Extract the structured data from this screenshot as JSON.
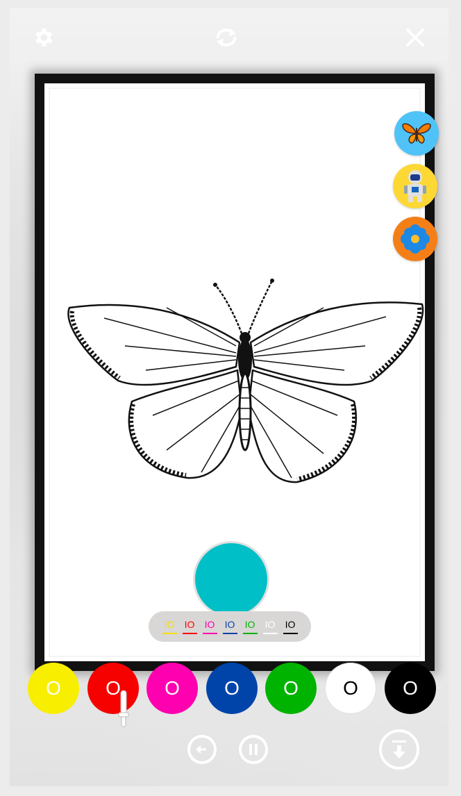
{
  "toolbar": {
    "settings_icon": "gear-icon",
    "refresh_icon": "refresh-icon",
    "close_icon": "close-icon"
  },
  "image_pickers": [
    {
      "name": "butterfly-icon",
      "bg": "#4fc3f7"
    },
    {
      "name": "astronaut-icon",
      "bg": "#fdd835"
    },
    {
      "name": "flower-icon",
      "bg": "#f57f17"
    }
  ],
  "current_color": "#00bfc6",
  "mini_palette": [
    {
      "label": "IO",
      "color": "#f5e000"
    },
    {
      "label": "IO",
      "color": "#ff0000"
    },
    {
      "label": "IO",
      "color": "#ff00b0"
    },
    {
      "label": "IO",
      "color": "#0a43a8"
    },
    {
      "label": "IO",
      "color": "#00b300"
    },
    {
      "label": "IO",
      "color": "#ffffff"
    },
    {
      "label": "IO",
      "color": "#000000"
    }
  ],
  "swatches": [
    {
      "label": "O",
      "color": "#f8ee00",
      "text": "#ffffff"
    },
    {
      "label": "O",
      "color": "#f70000",
      "text": "#ffffff"
    },
    {
      "label": "O",
      "color": "#ff00b0",
      "text": "#ffffff"
    },
    {
      "label": "O",
      "color": "#0044aa",
      "text": "#ffffff"
    },
    {
      "label": "O",
      "color": "#00b300",
      "text": "#ffffff"
    },
    {
      "label": "O",
      "color": "#ffffff",
      "text": "#000000"
    },
    {
      "label": "O",
      "color": "#000000",
      "text": "#ffffff"
    }
  ],
  "controls": {
    "undo_icon": "undo-icon",
    "pause_icon": "pause-icon",
    "download_icon": "download-icon",
    "brush_icon": "brush-icon"
  }
}
